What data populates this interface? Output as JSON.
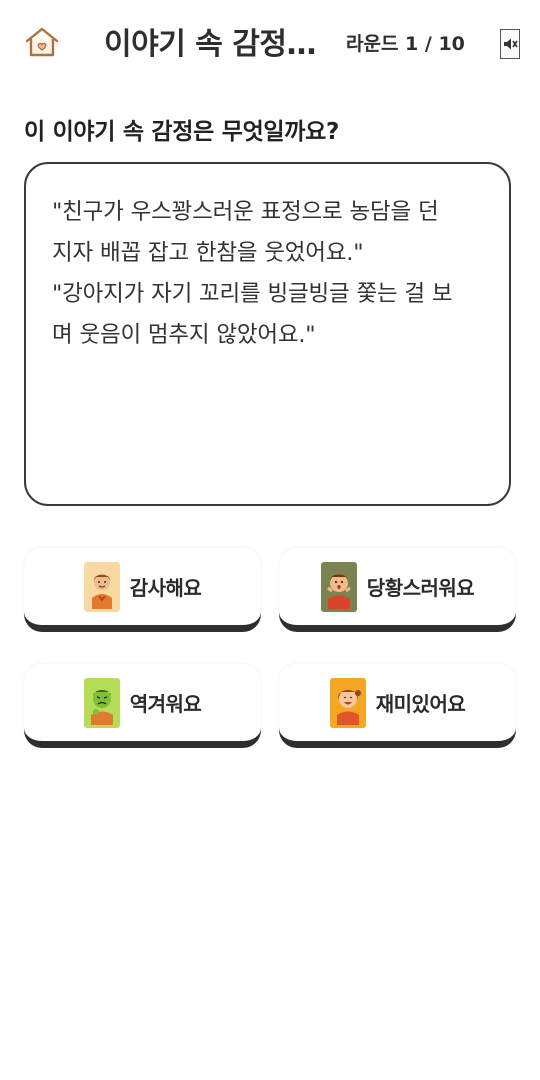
{
  "header": {
    "title": "이야기 속 감정 게임",
    "round_label": "라운드 1 / 10",
    "home_icon": "home-icon",
    "sound_icon": "sound-toggle-icon"
  },
  "question": "이 이야기 속 감정은 무엇일까요?",
  "story": {
    "lines": [
      "\"친구가 우스꽝스러운 표정으로 농담을 던",
      "지자 배꼽 잡고 한참을 웃었어요.\"",
      "\"강아지가 자기 꼬리를 빙글빙글 쫓는 걸 보",
      "며 웃음이 멈추지 않았어요.\""
    ]
  },
  "answers": [
    {
      "label": "감사해요",
      "face_color": "#f9d9a3",
      "icon": "grateful-face-icon"
    },
    {
      "label": "당황스러워요",
      "face_color": "#7b8450",
      "icon": "embarrassed-face-icon"
    },
    {
      "label": "역겨워요",
      "face_color": "#b6dd58",
      "icon": "disgusted-face-icon"
    },
    {
      "label": "재미있어요",
      "face_color": "#f5a623",
      "icon": "happy-face-icon"
    }
  ],
  "colors": {
    "border": "#3a3a3a",
    "text": "#2b2b2b",
    "home_icon_stroke": "#b0703a"
  }
}
